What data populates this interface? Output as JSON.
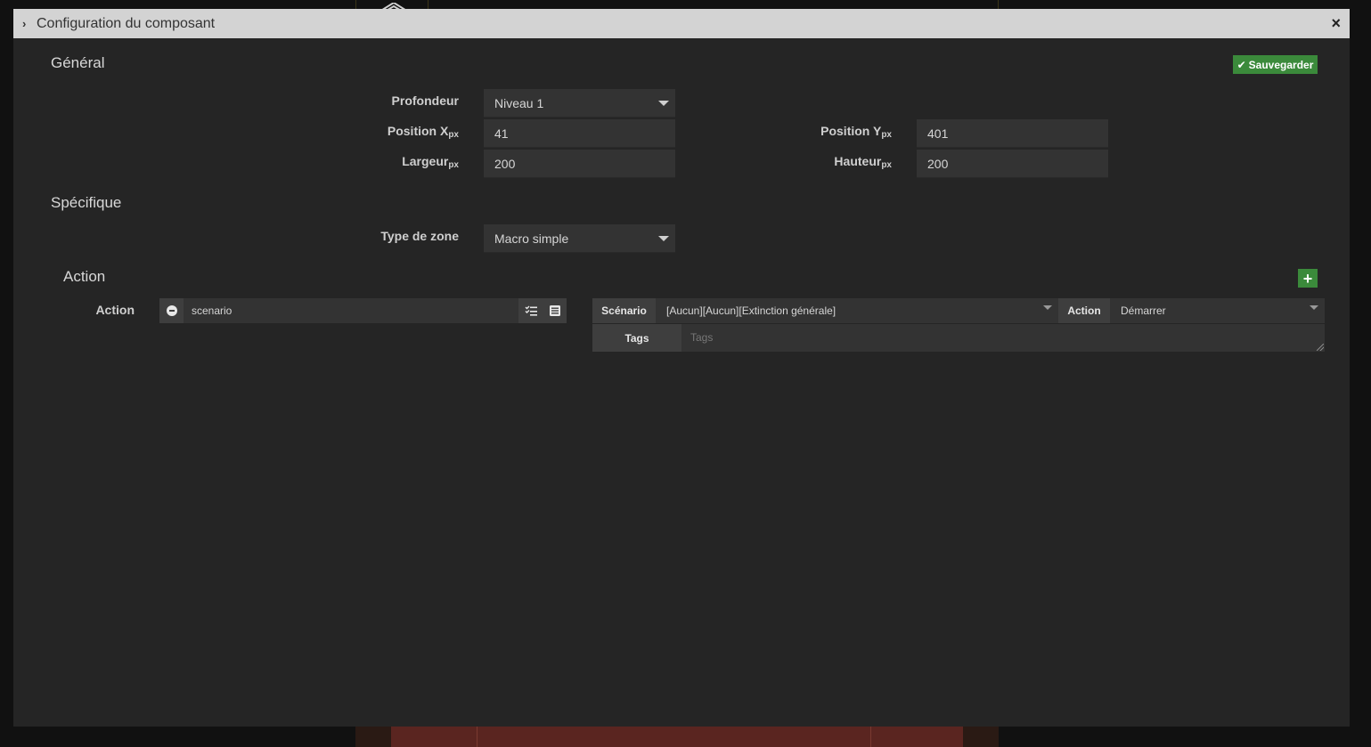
{
  "modal": {
    "title": "Configuration du composant",
    "close_glyph": "×",
    "save_label": "Sauvegarder"
  },
  "general": {
    "title": "Général",
    "depth_label": "Profondeur",
    "depth_value": "Niveau 1",
    "pos_x_label": "Position X",
    "pos_x_value": "41",
    "pos_y_label": "Position Y",
    "pos_y_value": "401",
    "width_label": "Largeur",
    "width_value": "200",
    "height_label": "Hauteur",
    "height_value": "200",
    "unit": "px"
  },
  "specific": {
    "title": "Spécifique",
    "zone_type_label": "Type de zone",
    "zone_type_value": "Macro simple"
  },
  "action_section": {
    "title": "Action",
    "row_label": "Action",
    "command_value": "scenario",
    "scenario_addon": "Scénario",
    "scenario_value": "[Aucun][Aucun][Extinction générale]",
    "action_addon": "Action",
    "action_value": "Démarrer",
    "tags_addon": "Tags",
    "tags_placeholder": "Tags"
  },
  "colors": {
    "header_bg": "#d3d3d3",
    "panel_bg": "#252525",
    "field_bg": "#333333",
    "success": "#3b8a3b"
  }
}
